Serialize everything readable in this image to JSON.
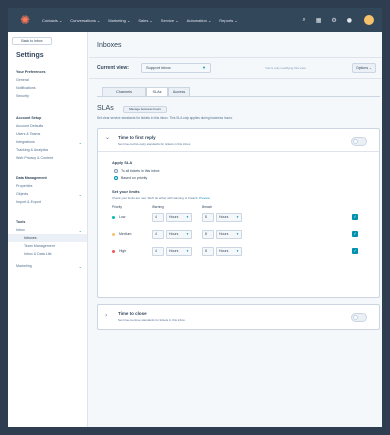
{
  "topnav": {
    "menu": [
      "Contacts ⌄",
      "Conversations ⌄",
      "Marketing ⌄",
      "Sales ⌄",
      "Service ⌄",
      "Automation ⌄",
      "Reports ⌄"
    ],
    "icons": [
      "search-icon",
      "marketplace-icon",
      "settings-icon",
      "notifications-icon",
      "avatar"
    ]
  },
  "sidebar": {
    "back_label": "Back to Inbox",
    "title": "Settings",
    "items": [
      {
        "label": "Your Preferences",
        "head": true
      },
      {
        "label": "General"
      },
      {
        "label": "Notifications"
      },
      {
        "label": "Security"
      },
      {
        "label": "Account Setup",
        "head": true
      },
      {
        "label": "Account Defaults"
      },
      {
        "label": "Users & Teams"
      },
      {
        "label": "Integrations",
        "chevron": "⌄"
      },
      {
        "label": "Tracking & Analytics"
      },
      {
        "label": "Web Privacy & Content"
      },
      {
        "label": "Data Management",
        "head": true
      },
      {
        "label": "Properties"
      },
      {
        "label": "Objects",
        "chevron": "⌄"
      },
      {
        "label": "Import & Export"
      },
      {
        "label": "Tools",
        "head": true
      },
      {
        "label": "Inbox",
        "chevron": "⌄"
      },
      {
        "label": "Inboxes",
        "active": true
      },
      {
        "label": "Team Management"
      },
      {
        "label": "Inbox & Data Lite"
      },
      {
        "label": "Marketing",
        "chevron": "⌄"
      }
    ]
  },
  "main": {
    "title": "Inboxes",
    "current_view_label": "Current view:",
    "current_view_value": "Support inbox",
    "view_note": "You're only modifying this view.",
    "options_label": "Options ⌄",
    "tabs": [
      "Channels",
      "SLAs",
      "Access"
    ],
    "active_tab": "SLAs",
    "slas_title": "SLAs",
    "business_hours_button": "Manage business hours",
    "slas_description": "Set clear service standards for tickets in this inbox. This SLA only applies during business hours.",
    "first_reply": {
      "title": "Time to first reply",
      "description": "Set time-to-first-reply standards for tickets in this inbox.",
      "toggle": "off",
      "apply_title": "Apply SLA",
      "options": [
        "To all tickets in this inbox",
        "Based on priority"
      ],
      "selected_option": "Based on priority",
      "limits_title": "Set your limits",
      "limits_desc": "Check your limits are met. We'll do either with warning or breach.",
      "limits_link": "Preview",
      "columns": [
        "Priority",
        "Warning",
        "Breach"
      ],
      "rows": [
        {
          "priority": "Low",
          "color": "#00bda5",
          "warning_value": "4",
          "warning_unit": "Hours",
          "breach_value": "8",
          "breach_unit": "Hours",
          "enabled": "✓"
        },
        {
          "priority": "Medium",
          "color": "#f5c26b",
          "warning_value": "4",
          "warning_unit": "Hours",
          "breach_value": "8",
          "breach_unit": "Hours",
          "enabled": "✓"
        },
        {
          "priority": "High",
          "color": "#f2545b",
          "warning_value": "4",
          "warning_unit": "Hours",
          "breach_value": "8",
          "breach_unit": "Hours",
          "enabled": "✓"
        }
      ]
    },
    "time_to_close": {
      "title": "Time to close",
      "description": "Set time-to-close standards for tickets in this inbox.",
      "toggle": "off"
    }
  },
  "colors": {
    "nav_bg": "#33475b",
    "accent": "#0091ae",
    "brand": "#ff7a59",
    "page_bg": "#f5f8fa"
  }
}
